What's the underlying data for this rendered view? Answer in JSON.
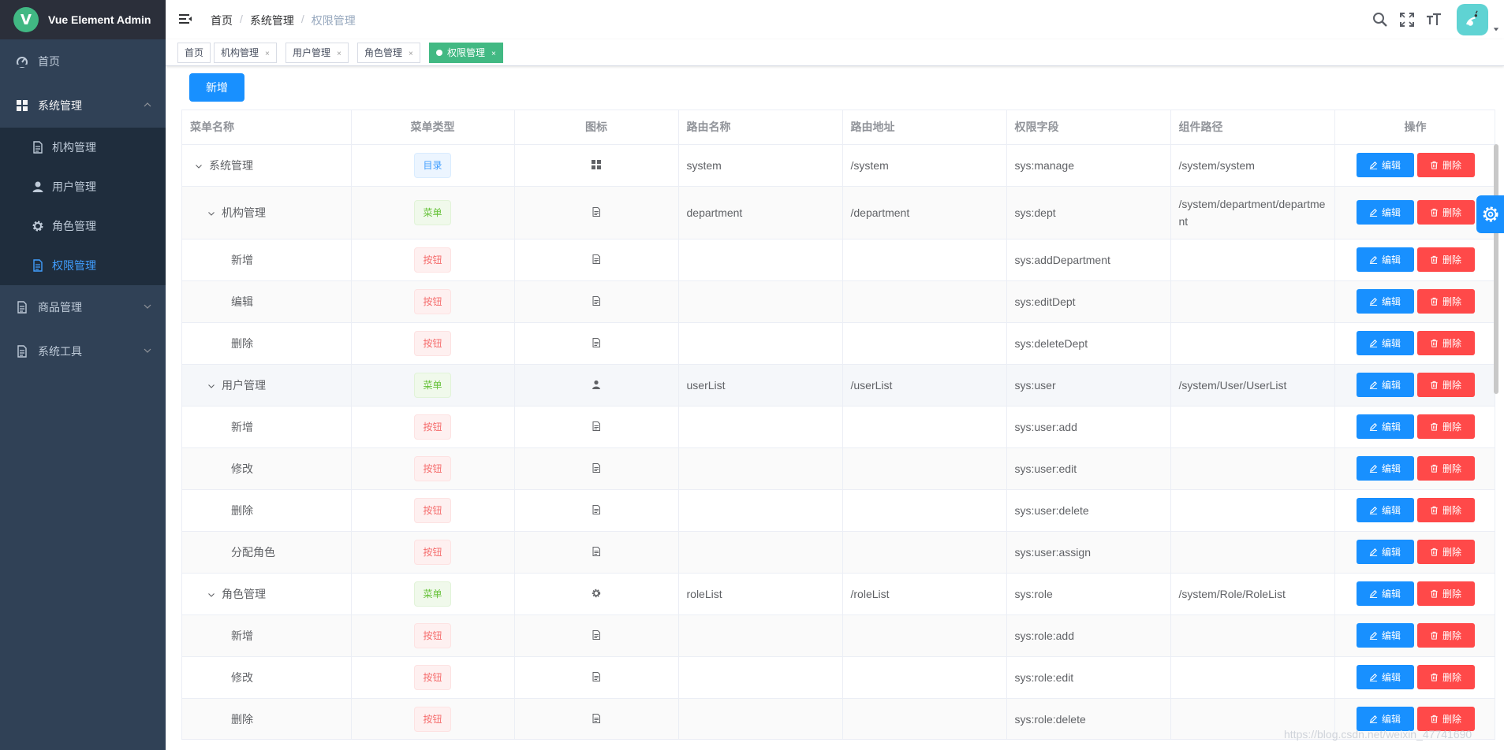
{
  "app": {
    "title": "Vue Element Admin",
    "logo_letter": "V"
  },
  "sidebar": {
    "items": [
      {
        "label": "首页",
        "icon": "dashboard-icon"
      },
      {
        "label": "系统管理",
        "icon": "grid-icon",
        "expanded": true,
        "children": [
          {
            "label": "机构管理",
            "icon": "document-icon"
          },
          {
            "label": "用户管理",
            "icon": "user-icon"
          },
          {
            "label": "角色管理",
            "icon": "gear-icon"
          },
          {
            "label": "权限管理",
            "icon": "document-icon",
            "active": true
          }
        ]
      },
      {
        "label": "商品管理",
        "icon": "document-icon"
      },
      {
        "label": "系统工具",
        "icon": "document-icon"
      }
    ]
  },
  "breadcrumb": [
    "首页",
    "系统管理",
    "权限管理"
  ],
  "tags": [
    {
      "label": "首页"
    },
    {
      "label": "机构管理",
      "close": "×"
    },
    {
      "label": "用户管理",
      "close": "×"
    },
    {
      "label": "角色管理",
      "close": "×"
    },
    {
      "label": "权限管理",
      "close": "×",
      "active": true
    }
  ],
  "toolbar": {
    "add_label": "新增"
  },
  "table": {
    "columns": [
      "菜单名称",
      "菜单类型",
      "图标",
      "路由名称",
      "路由地址",
      "权限字段",
      "组件路径",
      "操作"
    ],
    "edit_label": "编辑",
    "delete_label": "删除",
    "rows": [
      {
        "name": "系统管理",
        "type": "目录",
        "icon": "grid-icon",
        "route_name": "system",
        "route_path": "/system",
        "perm": "sys:manage",
        "component": "/system/system"
      },
      {
        "name": "机构管理",
        "type": "菜单",
        "icon": "document-icon",
        "route_name": "department",
        "route_path": "/department",
        "perm": "sys:dept",
        "component": "/system/department/department"
      },
      {
        "name": "新增",
        "type": "按钮",
        "icon": "document-icon",
        "route_name": "",
        "route_path": "",
        "perm": "sys:addDepartment",
        "component": ""
      },
      {
        "name": "编辑",
        "type": "按钮",
        "icon": "document-icon",
        "route_name": "",
        "route_path": "",
        "perm": "sys:editDept",
        "component": ""
      },
      {
        "name": "删除",
        "type": "按钮",
        "icon": "document-icon",
        "route_name": "",
        "route_path": "",
        "perm": "sys:deleteDept",
        "component": ""
      },
      {
        "name": "用户管理",
        "type": "菜单",
        "icon": "user-icon",
        "route_name": "userList",
        "route_path": "/userList",
        "perm": "sys:user",
        "component": "/system/User/UserList"
      },
      {
        "name": "新增",
        "type": "按钮",
        "icon": "document-icon",
        "route_name": "",
        "route_path": "",
        "perm": "sys:user:add",
        "component": ""
      },
      {
        "name": "修改",
        "type": "按钮",
        "icon": "document-icon",
        "route_name": "",
        "route_path": "",
        "perm": "sys:user:edit",
        "component": ""
      },
      {
        "name": "删除",
        "type": "按钮",
        "icon": "document-icon",
        "route_name": "",
        "route_path": "",
        "perm": "sys:user:delete",
        "component": ""
      },
      {
        "name": "分配角色",
        "type": "按钮",
        "icon": "document-icon",
        "route_name": "",
        "route_path": "",
        "perm": "sys:user:assign",
        "component": ""
      },
      {
        "name": "角色管理",
        "type": "菜单",
        "icon": "gear-icon",
        "route_name": "roleList",
        "route_path": "/roleList",
        "perm": "sys:role",
        "component": "/system/Role/RoleList"
      },
      {
        "name": "新增",
        "type": "按钮",
        "icon": "document-icon",
        "route_name": "",
        "route_path": "",
        "perm": "sys:role:add",
        "component": ""
      },
      {
        "name": "修改",
        "type": "按钮",
        "icon": "document-icon",
        "route_name": "",
        "route_path": "",
        "perm": "sys:role:edit",
        "component": ""
      },
      {
        "name": "删除",
        "type": "按钮",
        "icon": "document-icon",
        "route_name": "",
        "route_path": "",
        "perm": "sys:role:delete",
        "component": ""
      }
    ]
  },
  "watermark": "https://blog.csdn.net/weixin_47741690",
  "colors": {
    "sidebar_bg": "#304156",
    "primary": "#1890ff",
    "danger": "#ff4949",
    "tag_active": "#42b983"
  }
}
